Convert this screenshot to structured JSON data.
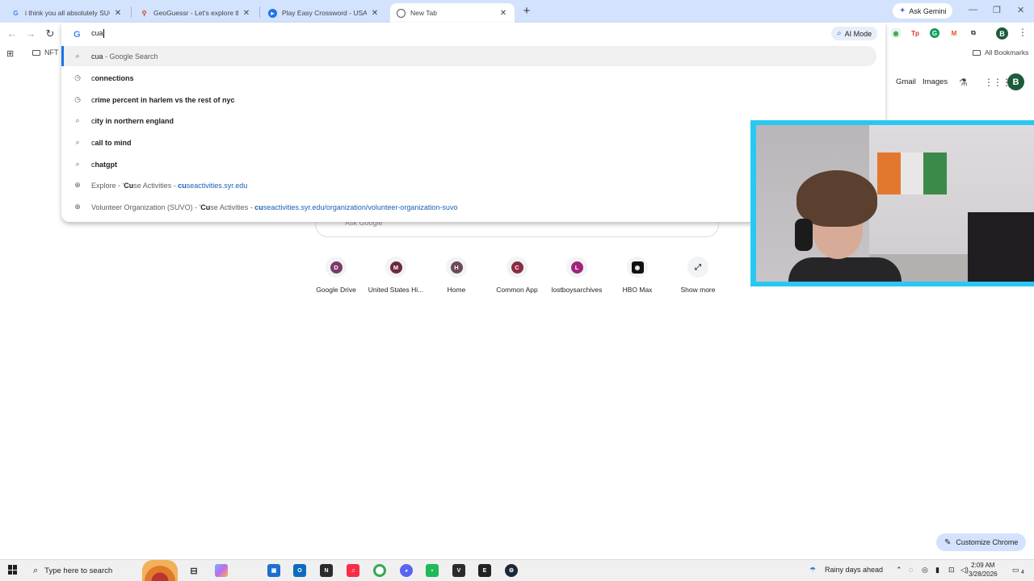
{
  "tabs": [
    {
      "title": "i think you all absolutely SUCK",
      "favicon": "G"
    },
    {
      "title": "GeoGuessr - Let's explore the w",
      "favicon": ""
    },
    {
      "title": "Play Easy Crossword - USA TOD",
      "favicon": ""
    },
    {
      "title": "New Tab",
      "favicon": ""
    }
  ],
  "ask_gemini": "Ask Gemini",
  "omnibox": {
    "value": "cua",
    "ai_mode": "AI Mode",
    "suggestions": [
      {
        "type": "search",
        "pre": "cua",
        "post": " - Google Search"
      },
      {
        "type": "history",
        "first": "c",
        "rest": "onnections"
      },
      {
        "type": "history",
        "first": "c",
        "rest": "rime percent in harlem vs the rest of nyc"
      },
      {
        "type": "search",
        "first": "c",
        "rest": "ity in northern england"
      },
      {
        "type": "search",
        "first": "c",
        "rest": "all to mind"
      },
      {
        "type": "search",
        "first": "c",
        "rest": "hatgpt"
      },
      {
        "type": "site",
        "label_a": "Explore - '",
        "label_b": "Cu",
        "label_c": "se Activities - ",
        "url_a": "cu",
        "url_b": "seactivities.syr.edu"
      },
      {
        "type": "site",
        "label_a": "Volunteer Organization (SUVO) - '",
        "label_b": "Cu",
        "label_c": "se Activities - ",
        "url_a": "cu",
        "url_b": "seactivities.syr.edu/organization/volunteer-organization-suvo"
      }
    ]
  },
  "bookmarks": {
    "folder": "NFT",
    "all": "All Bookmarks"
  },
  "ntp": {
    "gmail": "Gmail",
    "images": "Images",
    "profile_initial": "B",
    "search_placeholder": "Ask Google",
    "shortcuts": [
      {
        "initial": "D",
        "label": "Google Drive",
        "color": "#7a3b6b"
      },
      {
        "initial": "M",
        "label": "United States Hi...",
        "color": "#6b2a3b"
      },
      {
        "initial": "H",
        "label": "Home",
        "color": "#6b4a5b"
      },
      {
        "initial": "C",
        "label": "Common App",
        "color": "#8b2b44"
      },
      {
        "initial": "L",
        "label": "lostboysarchives",
        "color": "#a0247a"
      },
      {
        "initial": "",
        "label": "HBO Max",
        "color": "#111111"
      },
      {
        "initial": "",
        "label": "Show more",
        "color": ""
      }
    ],
    "customize": "Customize Chrome"
  },
  "taskbar": {
    "search_placeholder": "Type here to search",
    "weather": "Rainy days ahead",
    "time": "2:09 AM",
    "date": "3/28/2026",
    "notifications": "4"
  }
}
